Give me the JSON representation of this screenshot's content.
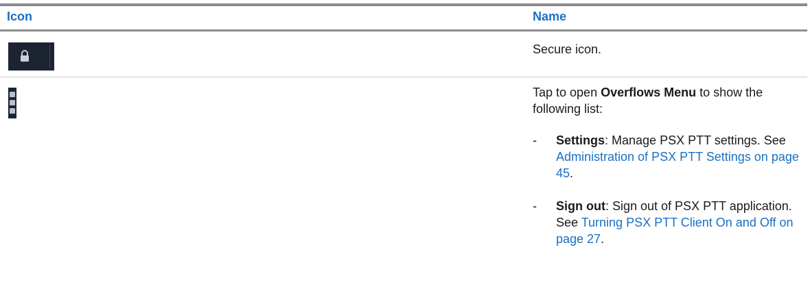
{
  "table": {
    "header": {
      "icon_label": "Icon",
      "name_label": "Name"
    },
    "rows": [
      {
        "icon": "lock-icon",
        "text": "Secure icon."
      },
      {
        "icon": "overflow-menu-icon",
        "intro_prefix": "Tap to open ",
        "intro_bold": "Overflows Menu",
        "intro_suffix": " to show the following list:",
        "items": [
          {
            "dash": "-",
            "term": "Settings",
            "desc": ": Manage PSX PTT settings. See ",
            "link": "Administration of PSX PTT Settings on page 45",
            "end": "."
          },
          {
            "dash": "-",
            "term": "Sign out",
            "desc": ": Sign out of PSX PTT application. See ",
            "link": "Turning PSX PTT Client On and Off on page 27",
            "end": "."
          }
        ]
      }
    ]
  },
  "colors": {
    "heading": "#1a6fc4",
    "link": "#1a6fc4",
    "icon_tile": "#1b2430",
    "icon_glyph": "#c9ced6",
    "rule": "#8c8c8c"
  }
}
